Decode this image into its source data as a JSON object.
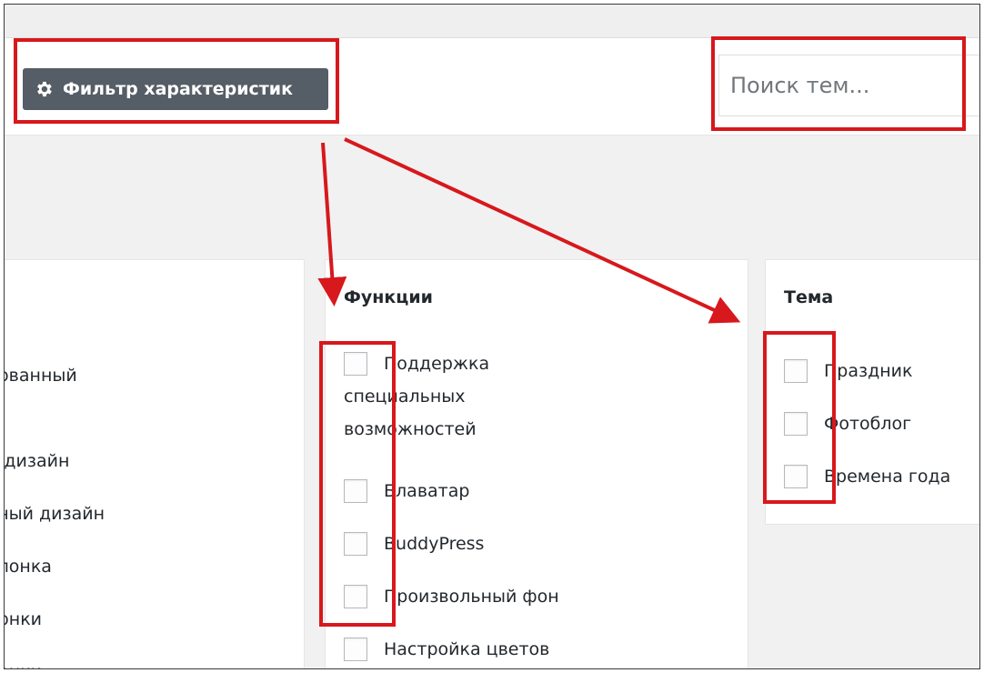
{
  "toolbar": {
    "filter_button_label": "Фильтр характеристик",
    "search_placeholder": "Поиск тем..."
  },
  "left_panel": {
    "items": [
      "рованный",
      "й дизайн",
      "вный дизайн",
      "олонка",
      "лонки",
      "лонки"
    ]
  },
  "features_panel": {
    "title": "Функции",
    "items": [
      {
        "label_lines": [
          "Поддержка",
          "специальных",
          "возможностей"
        ],
        "checked": false
      },
      {
        "label": "Блаватар",
        "checked": false
      },
      {
        "label": "BuddyPress",
        "checked": false
      },
      {
        "label": "Произвольный фон",
        "checked": false
      },
      {
        "label": "Настройка цветов",
        "checked": false
      }
    ]
  },
  "subject_panel": {
    "title": "Тема",
    "items": [
      {
        "label": "Праздник",
        "checked": false
      },
      {
        "label": "Фотоблог",
        "checked": false
      },
      {
        "label": "Времена года",
        "checked": false
      }
    ]
  },
  "colors": {
    "button_bg": "#555d66",
    "annotation_red": "#d7181c",
    "page_bg": "#f1f1f1"
  },
  "icons": {
    "filter": "gear-icon"
  }
}
